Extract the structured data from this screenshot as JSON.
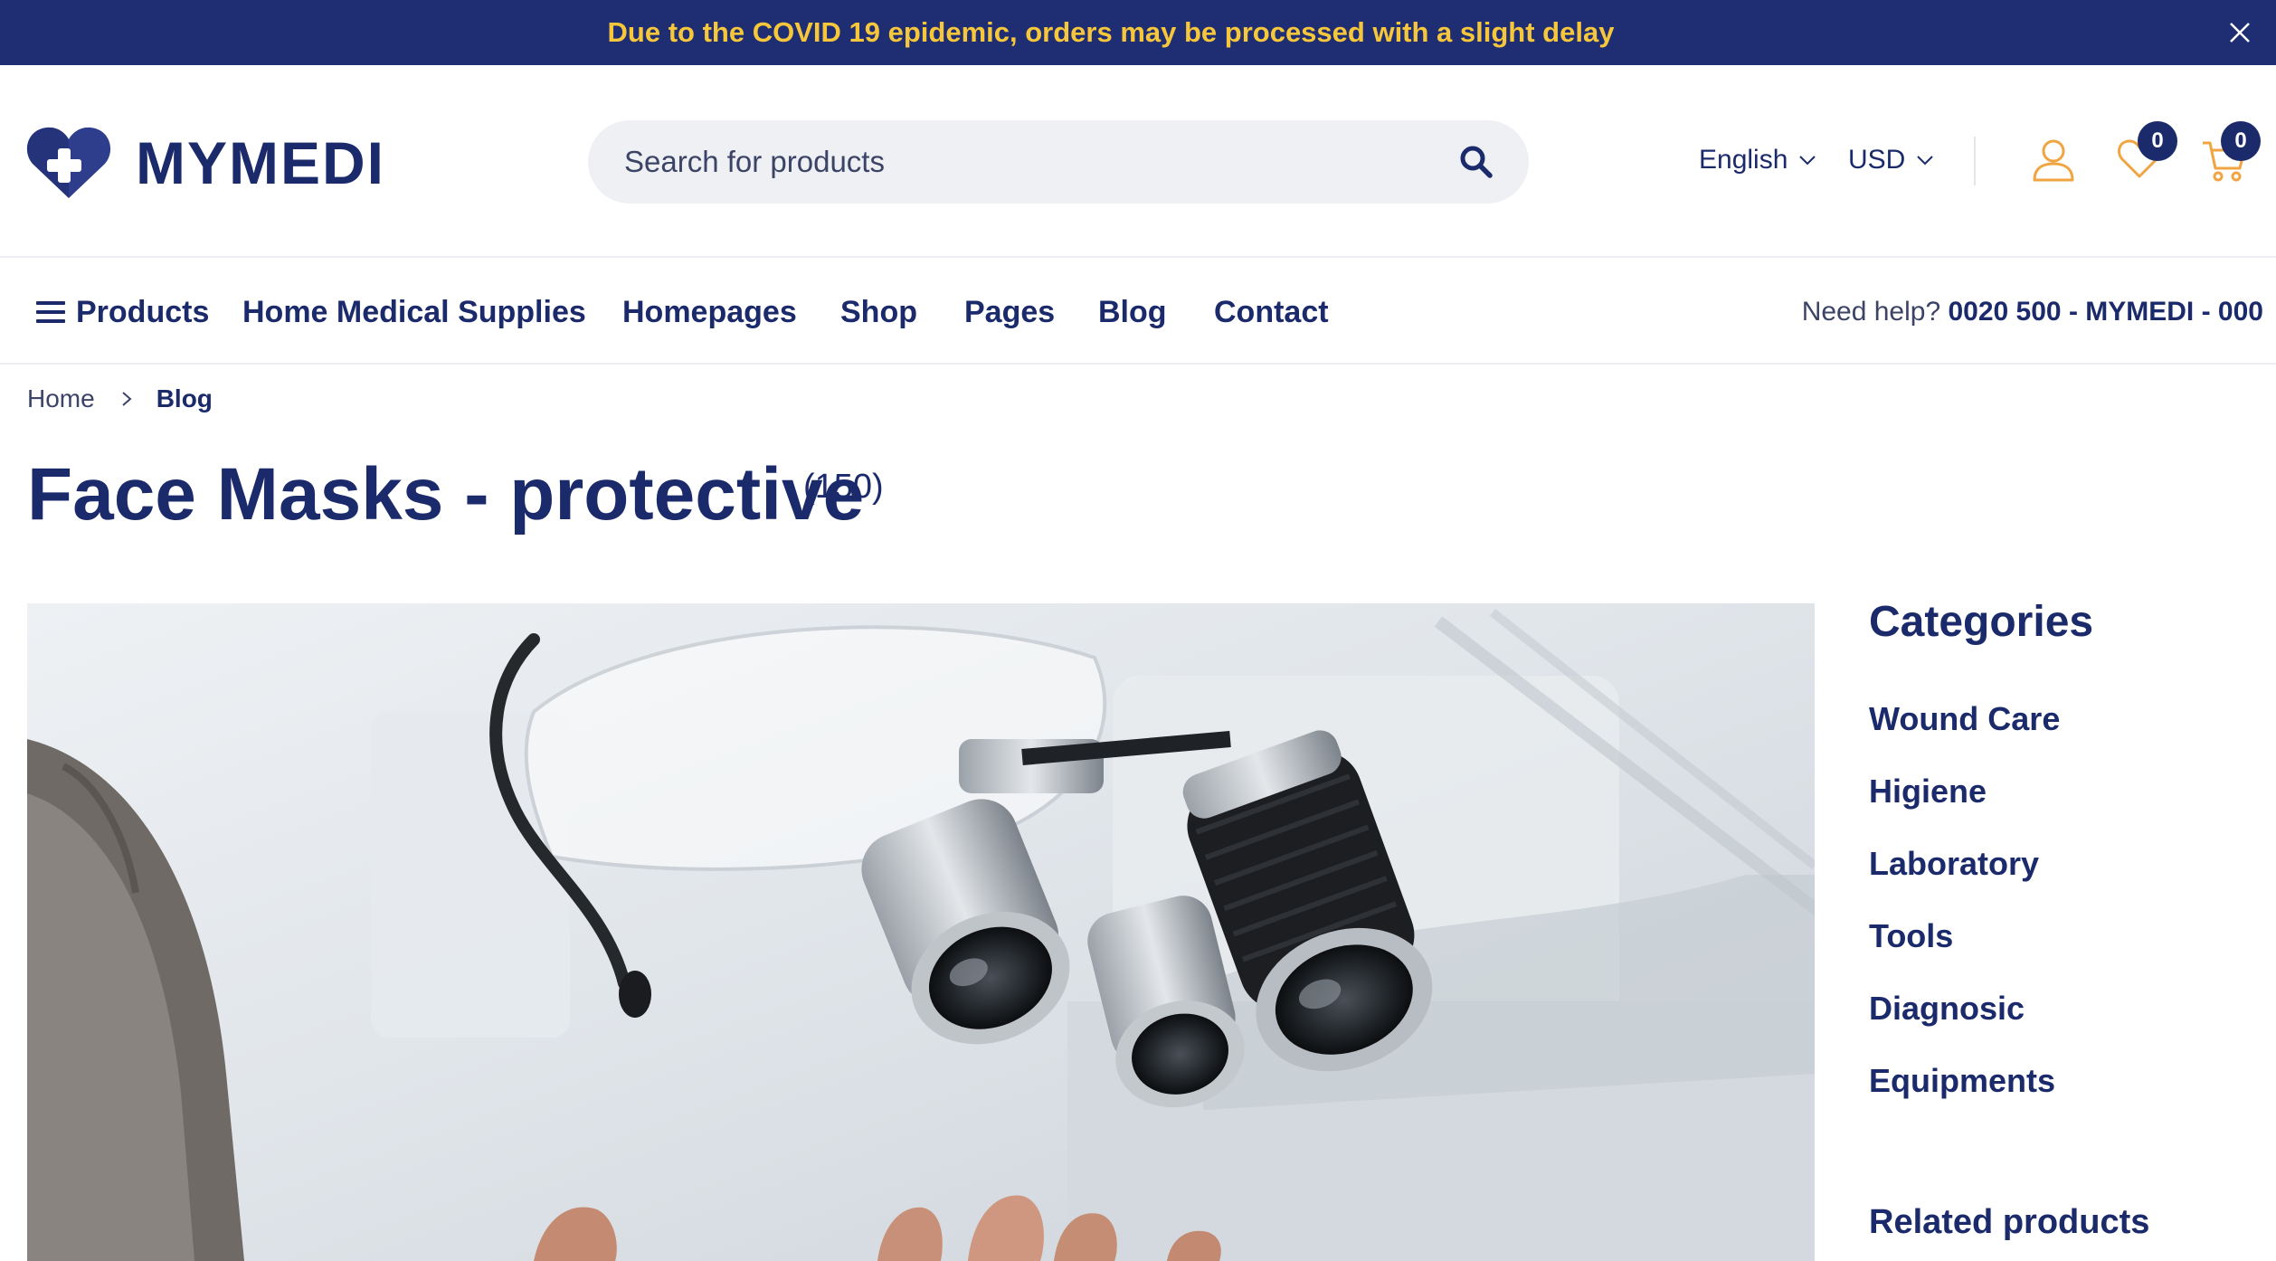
{
  "banner": {
    "text_before": "Due to the ",
    "text_bold": "COVID 19",
    "text_after": " epidemic, orders may be processed with a slight delay"
  },
  "brand": {
    "name": "MYMEDI"
  },
  "search": {
    "placeholder": "Search for products"
  },
  "header": {
    "language": "English",
    "currency": "USD",
    "wishlist_count": "0",
    "cart_count": "0"
  },
  "nav": {
    "items": [
      "Products",
      "Home Medical Supplies",
      "Homepages",
      "Shop",
      "Pages",
      "Blog",
      "Contact"
    ],
    "help_label": "Need help? ",
    "help_phone": "0020 500 - MYMEDI - 000"
  },
  "breadcrumb": {
    "home": "Home",
    "current": "Blog"
  },
  "page": {
    "title": "Face Masks - protective",
    "count": "(150)"
  },
  "sidebar": {
    "title": "Categories",
    "categories": [
      "Wound Care",
      "Higiene",
      "Laboratory",
      "Tools",
      "Diagnosic",
      "Equipments"
    ],
    "related_title": "Related products"
  },
  "colors": {
    "primary": "#1b2a6b",
    "banner_bg": "#1f2d72",
    "banner_text": "#f7c73b",
    "accent": "#f0a542"
  },
  "icons": [
    "close-icon",
    "logo-heart-icon",
    "search-icon",
    "chevron-down-icon",
    "user-icon",
    "heart-icon",
    "cart-icon",
    "menu-icon",
    "chevron-right-icon"
  ]
}
